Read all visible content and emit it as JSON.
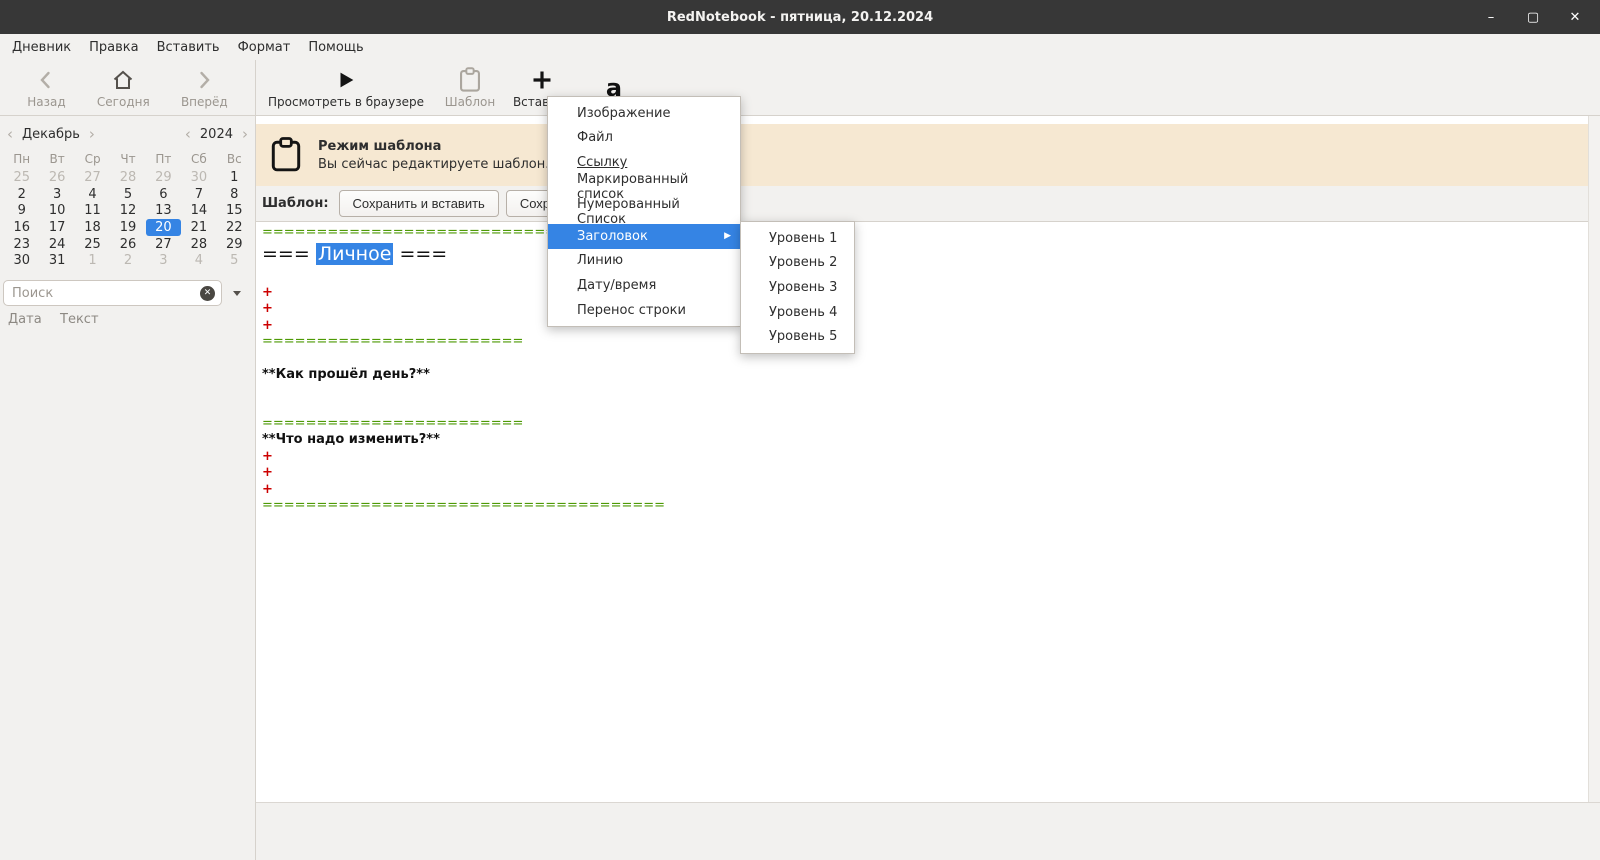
{
  "colors": {
    "accent": "#3584e4",
    "titlebar_bg": "#373737",
    "chrome_bg": "#f2f1ef",
    "banner_bg": "#f6e8d2",
    "editor_green": "#4e9a06",
    "editor_red": "#cc0000"
  },
  "titlebar": {
    "title": "RedNotebook - пятница, 20.12.2024"
  },
  "window_controls": {
    "minimize": "–",
    "maximize": "▢",
    "close": "✕"
  },
  "menubar": {
    "items": [
      "Дневник",
      "Правка",
      "Вставить",
      "Формат",
      "Помощь"
    ]
  },
  "toolbar": {
    "back": "Назад",
    "today": "Сегодня",
    "forward": "Вперёд",
    "preview": "Просмотреть в браузере",
    "template": "Шаблон",
    "insert": "Вставить",
    "format_glyph": "a"
  },
  "calendar": {
    "prev": "‹",
    "next": "›",
    "month": "Декабрь",
    "year": "2024",
    "day_headers": [
      "Пн",
      "Вт",
      "Ср",
      "Чт",
      "Пт",
      "Сб",
      "Вс"
    ],
    "weeks": [
      [
        {
          "d": "25",
          "muted": true
        },
        {
          "d": "26",
          "muted": true
        },
        {
          "d": "27",
          "muted": true
        },
        {
          "d": "28",
          "muted": true
        },
        {
          "d": "29",
          "muted": true
        },
        {
          "d": "30",
          "muted": true
        },
        {
          "d": "1"
        }
      ],
      [
        {
          "d": "2"
        },
        {
          "d": "3"
        },
        {
          "d": "4"
        },
        {
          "d": "5"
        },
        {
          "d": "6"
        },
        {
          "d": "7"
        },
        {
          "d": "8"
        }
      ],
      [
        {
          "d": "9"
        },
        {
          "d": "10"
        },
        {
          "d": "11"
        },
        {
          "d": "12"
        },
        {
          "d": "13"
        },
        {
          "d": "14"
        },
        {
          "d": "15"
        }
      ],
      [
        {
          "d": "16"
        },
        {
          "d": "17"
        },
        {
          "d": "18"
        },
        {
          "d": "19"
        },
        {
          "d": "20",
          "selected": true
        },
        {
          "d": "21"
        },
        {
          "d": "22"
        }
      ],
      [
        {
          "d": "23"
        },
        {
          "d": "24"
        },
        {
          "d": "25"
        },
        {
          "d": "26"
        },
        {
          "d": "27"
        },
        {
          "d": "28"
        },
        {
          "d": "29"
        }
      ],
      [
        {
          "d": "30"
        },
        {
          "d": "31"
        },
        {
          "d": "1",
          "muted": true
        },
        {
          "d": "2",
          "muted": true
        },
        {
          "d": "3",
          "muted": true
        },
        {
          "d": "4",
          "muted": true
        },
        {
          "d": "5",
          "muted": true
        }
      ]
    ]
  },
  "search": {
    "placeholder": "Поиск"
  },
  "results": {
    "columns": [
      "Дата",
      "Текст"
    ]
  },
  "banner": {
    "title": "Режим шаблона",
    "subtitle": "Вы сейчас редактируете шаблон."
  },
  "template_bar": {
    "label": "Шаблон:",
    "save_insert": "Сохранить и вставить",
    "save": "Сохранить"
  },
  "editor": {
    "lines": [
      {
        "t": "green",
        "text": "====================================="
      },
      {
        "t": "heading",
        "pre": "=== ",
        "sel": "Личное",
        "post": " ==="
      },
      {
        "t": "blank"
      },
      {
        "t": "red",
        "text": "+"
      },
      {
        "t": "red",
        "text": "+"
      },
      {
        "t": "red",
        "text": "+"
      },
      {
        "t": "green",
        "text": "========================"
      },
      {
        "t": "blank"
      },
      {
        "t": "bold",
        "text": "**Как прошёл день?**"
      },
      {
        "t": "blank"
      },
      {
        "t": "blank"
      },
      {
        "t": "green",
        "text": "========================"
      },
      {
        "t": "bold",
        "text": "**Что надо изменить?**"
      },
      {
        "t": "red",
        "text": "+"
      },
      {
        "t": "red",
        "text": "+"
      },
      {
        "t": "red",
        "text": "+"
      },
      {
        "t": "green",
        "text": "====================================="
      }
    ]
  },
  "insert_menu": {
    "items": [
      {
        "label": "Изображение"
      },
      {
        "label": "Файл"
      },
      {
        "label": "Ссылку",
        "underline": true
      },
      {
        "label": "Маркированный список"
      },
      {
        "label": "Нумерованный Список"
      },
      {
        "label": "Заголовок",
        "active": true,
        "has_submenu": true
      },
      {
        "label": "Линию"
      },
      {
        "label": "Дату/время"
      },
      {
        "label": "Перенос строки"
      }
    ],
    "submenu_arrow": "▶"
  },
  "header_submenu": {
    "items": [
      "Уровень 1",
      "Уровень 2",
      "Уровень 3",
      "Уровень 4",
      "Уровень 5"
    ]
  }
}
